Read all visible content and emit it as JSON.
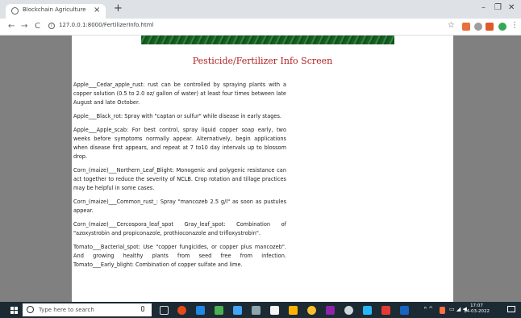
{
  "browser": {
    "tab_title": "Blockchain Agriculture",
    "tab_close": "×",
    "new_tab": "+",
    "minimize": "–",
    "maximize": "❐",
    "close": "✕",
    "back": "←",
    "forward": "→",
    "reload": "C",
    "url": "127.0.0.1:8000/FertilizerInfo.html",
    "menu": "⋮"
  },
  "page": {
    "title": "Pesticide/Fertilizer Info Screen",
    "entries": [
      "Apple___Cedar_apple_rust: rust can be controlled by spraying plants with a copper solution (0.5 to 2.0 oz/ gallon of water) at least four times between late August and late October.",
      "Apple___Black_rot: Spray with \"captan or sulfur\" while disease in early stages.",
      "Apple___Apple_scab: For best control, spray liquid copper soap early, two weeks before symptoms normally appear. Alternatively, begin applications when disease first appears, and repeat at 7 to10 day intervals up to blossom drop.",
      "Corn_(maize)___Northern_Leaf_Blight: Monogenic and polygenic resistance can act together to reduce the severity of NCLB. Crop rotation and tillage practices may be helpful in some cases.",
      "Corn_(maize)___Common_rust_: Spray \"mancozeb 2.5 g/l\" as soon as pustules appear.",
      "Corn_(maize)___Cercospora_leaf_spot Gray_leaf_spot: Combination of \"azoxystrobin and propiconazole, prothioconazole and trifloxystrobin\".",
      "Tomato___Bacterial_spot: Use \"copper fungicides, or copper plus mancozeb\". And growing healthy plants from seed free from infection. Tomato___Early_blight: Combination of copper sulfate and lime."
    ]
  },
  "taskbar": {
    "search_placeholder": "Type here to search",
    "time": "17:07",
    "date": "14-03-2022",
    "tray_symbols": "ᴿ ^"
  },
  "colors": {
    "title_red": "#b01e1e",
    "page_gray": "#808080",
    "banner_green": "#1f6b2d",
    "taskbar": "#1c2a33"
  }
}
